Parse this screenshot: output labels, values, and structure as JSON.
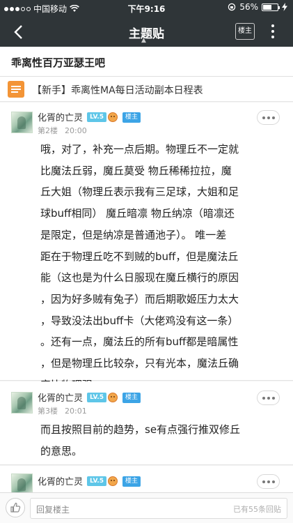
{
  "status_bar": {
    "carrier": "中国移动",
    "time": "下午9:16",
    "battery": "56%",
    "battery_level": 0.56
  },
  "nav": {
    "title": "主题贴",
    "owner_button": "楼主"
  },
  "forum": {
    "name": "乖离性百万亚瑟王吧"
  },
  "thread": {
    "title": "【新手】乖离性MA每日活动副本日程表"
  },
  "posts": [
    {
      "user": "化胥的亡灵",
      "level": "LV.5",
      "badge": "楼主",
      "floor": "第2楼",
      "time": "20:00",
      "lines": [
        "哦，对了，补充一点后期。物理丘不一定就",
        "比魔法丘弱，魔丘莫受 物丘稀稀拉拉，魔",
        "丘大姐（物理丘表示我有三足球，大姐和足",
        "球buff相同） 魔丘暗凛 物丘纳凉（暗凛还",
        "是限定，但是纳凉是普通池子）。 唯一差",
        "距在于物理丘吃不到贼的buff，但是魔法丘",
        "能（这也是为什么日服现在魔丘横行的原因",
        "，因为好多贼有兔子）而后期歌姬压力太大",
        "，导致没法出buff卡（大佬鸡没有这一条）",
        "。还有一点，魔法丘的所有buff都是暗属性",
        "，但是物理丘比较杂，只有光本，魔法丘确",
        "实比物理强"
      ]
    },
    {
      "user": "化胥的亡灵",
      "level": "LV.5",
      "badge": "楼主",
      "floor": "第3楼",
      "time": "20:01",
      "lines": [
        "而且按照目前的趋势，se有点强行推双修丘",
        "的意思。"
      ]
    },
    {
      "user": "化胥的亡灵",
      "level": "LV.5",
      "badge": "楼主"
    }
  ],
  "bottom_bar": {
    "reply_placeholder": "回复楼主",
    "reply_count": "已有55条回贴"
  },
  "colors": {
    "navbar_bg": "#2f3538",
    "thread_icon": "#f39436",
    "level_badge": "#5ec6e8",
    "owner_badge": "#3ca4e6"
  }
}
